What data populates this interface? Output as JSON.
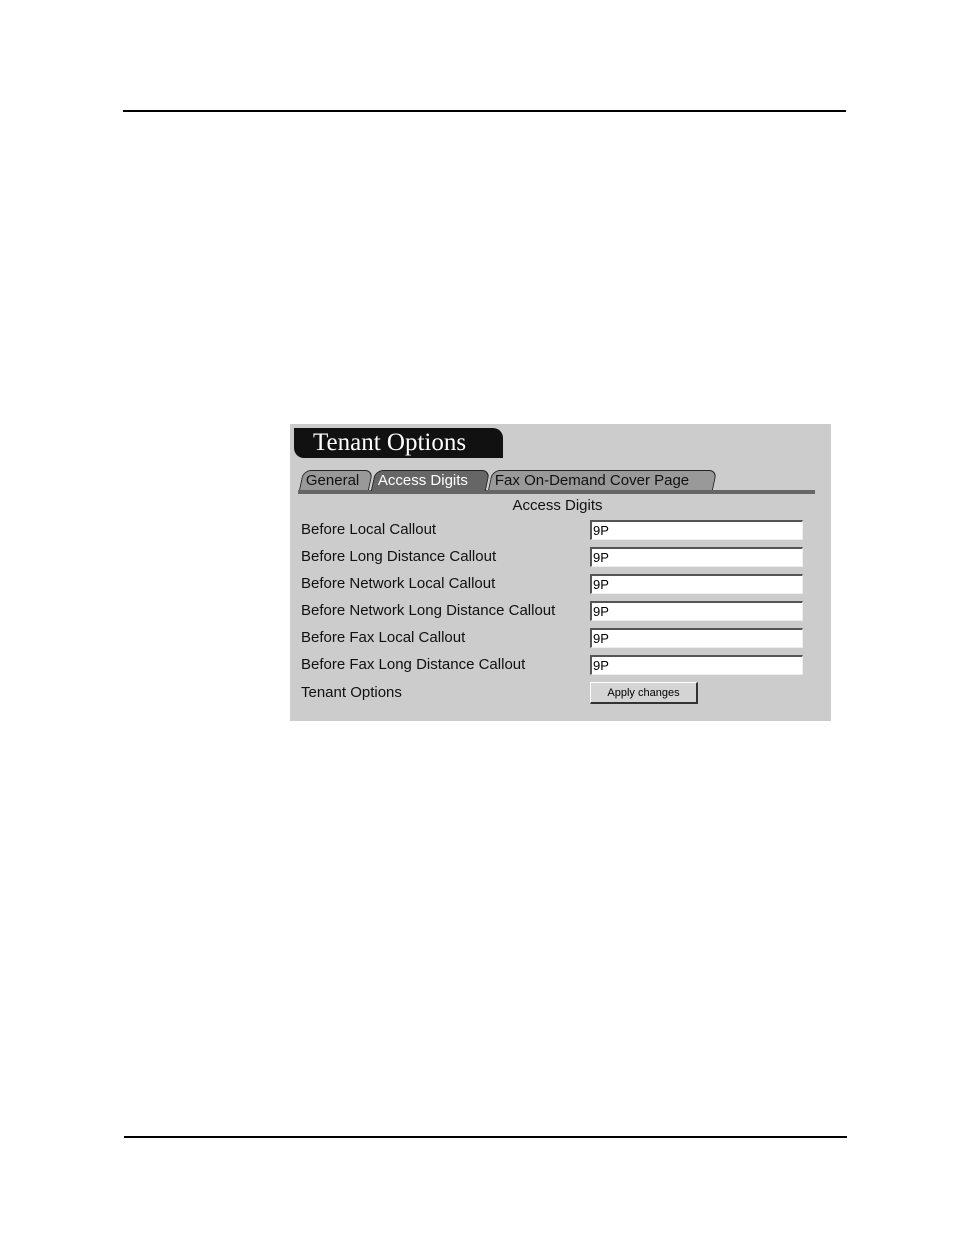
{
  "panel": {
    "title": "Tenant Options",
    "tabs": [
      {
        "label": "General",
        "active": false
      },
      {
        "label": "Access Digits",
        "active": true
      },
      {
        "label": "Fax On-Demand Cover Page",
        "active": false
      }
    ],
    "section_heading": "Access Digits",
    "rows": [
      {
        "label": "Before Local Callout",
        "value": "9P"
      },
      {
        "label": "Before Long Distance Callout",
        "value": "9P"
      },
      {
        "label": "Before Network Local Callout",
        "value": "9P"
      },
      {
        "label": "Before Network Long Distance Callout",
        "value": "9P"
      },
      {
        "label": "Before Fax Local Callout",
        "value": "9P"
      },
      {
        "label": "Before Fax Long Distance Callout",
        "value": "9P"
      }
    ],
    "footer_label": "Tenant Options",
    "apply_button": "Apply changes"
  },
  "colors": {
    "panel_bg": "#cccccc",
    "banner_bg": "#111111",
    "active_tab": "#666666",
    "inactive_tab": "#999999"
  }
}
